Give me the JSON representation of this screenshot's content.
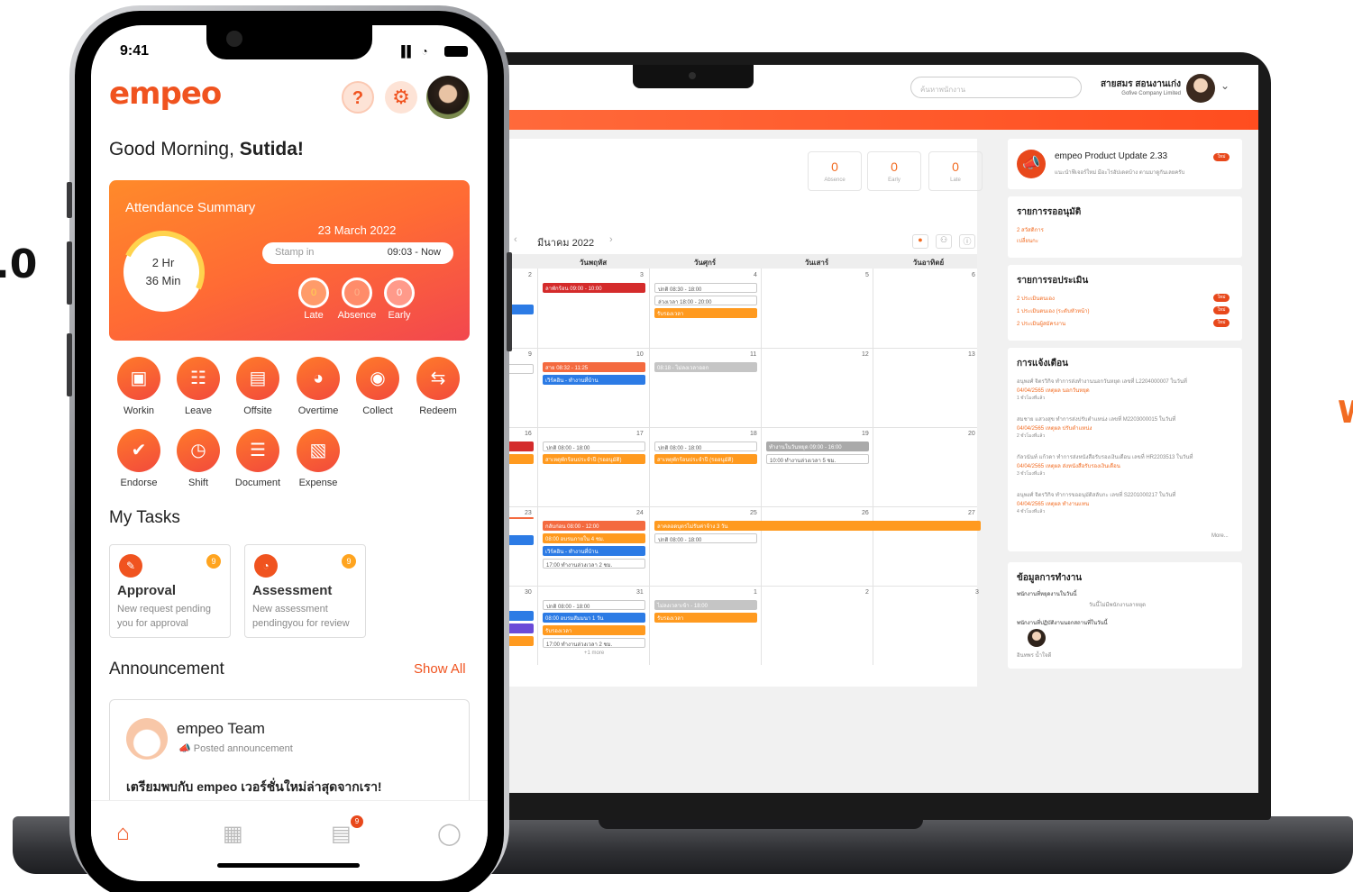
{
  "edge": {
    "left_text": ".0",
    "right_text": "W"
  },
  "web": {
    "search_placeholder": "ค้นหาพนักงาน",
    "user_name": "สายสมร สอนงานเก่ง",
    "company": "Gofive Company Limited",
    "counters": [
      {
        "value": "0",
        "label": "Absence"
      },
      {
        "value": "0",
        "label": "Early"
      },
      {
        "value": "0",
        "label": "Late"
      }
    ],
    "month": "มีนาคม 2022",
    "weekdays": [
      "วันพฤหัส",
      "วันศุกร์",
      "วันเสาร์",
      "วันอาทิตย์"
    ],
    "weeks": [
      {
        "days": [
          "2",
          "3",
          "4",
          "5",
          "6"
        ]
      },
      {
        "days": [
          "9",
          "10",
          "11",
          "12",
          "13"
        ]
      },
      {
        "days": [
          "16",
          "17",
          "18",
          "19",
          "20"
        ]
      },
      {
        "days": [
          "23",
          "24",
          "25",
          "26",
          "27"
        ]
      },
      {
        "days": [
          "30",
          "31",
          "1",
          "2",
          "3"
        ]
      }
    ],
    "events": {
      "e1": "ลาพักร้อน 09:00 - 10:00",
      "e2": "ปกติ 08:30 - 18:00",
      "e3": "ล่วงเวลา 18:00 - 20:00",
      "e4": "รับรองเวลา",
      "e5": "สาย 08:32 - 11:25",
      "e6": "เวิร์คอิน - ทำงานที่บ้าน",
      "e7": "08:18 - ไม่ลงเวลาออก",
      "e8": "ปกติ 08:00 - 18:00",
      "e9": "สาเหตุพักร้อนประจำปี (รออนุมัติ)",
      "e10": "ปกติ 08:00 - 18:00",
      "e11": "สาเหตุพักร้อนประจำปี (รออนุมัติ)",
      "e12": "ทำงานในวันหยุด 09:00 - 16:00",
      "e13": "10:00 ทำงานล่วงเวลา 5 ชม.",
      "e14": "กลับก่อน 08:00 - 12:00",
      "e15": "08:00 อบรมภายใน 4 ชม.",
      "e16": "เวิร์คอิน - ทำงานที่บ้าน",
      "e17": "17:00 ทำงานล่วงเวลา 2 ชม.",
      "e18": "ลาคลอดบุตรไม่รับค่าจ้าง 3 วัน",
      "e19": "ปกติ 08:00 - 18:00",
      "e20": "ปกติ 08:00 - 18:00",
      "e21": "08:00 อบรมสัมมนา 1 วัน",
      "e22": "รับรองเวลา",
      "e23": "17:00 ทำงานล่วงเวลา 2 ชม.",
      "e24": "+1 more",
      "e25": "ไม่ลงเวลาเข้า - 18:00",
      "e26": "รับรองเวลา"
    },
    "product_update": {
      "title": "empeo Product Update 2.33",
      "badge": "ใหม่",
      "desc": "แนะนำฟีเจอร์ใหม่ มีอะไรอัปเดตบ้าง ตามมาดูกันเลยครับ"
    },
    "approval_card": {
      "title": "รายการรออนุมัติ",
      "l1": "2 สวัสดิการ",
      "l2": "เปลี่ยนกะ"
    },
    "assess_card": {
      "title": "รายการรอประเมิน",
      "l1": "2 ประเมินตนเอง",
      "l2": "1 ประเมินตนเอง (ระดับหัวหน้า)",
      "l3": "2 ประเมินผู้สมัครงาน",
      "badge": "ใหม่"
    },
    "notif_card": {
      "title": "การแจ้งเตือน",
      "items": [
        {
          "a": "อนุพงศ์ จิตรวิกิจ ทำการส่งทำงานนอกวันหยุด เลขที่ L2204000007 ในวันที่",
          "b": "04/04/2565 เหตุผล นอกวันหยุด",
          "c": "1 ชั่วโมงที่แล้ว"
        },
        {
          "a": "สมชาย แสวงสุข ทำการส่งปรับตำแหน่ง เลขที่ M2203000015 ในวันที่",
          "b": "04/04/2565 เหตุผล ปรับตำแหน่ง",
          "c": "2 ชั่วโมงที่แล้ว"
        },
        {
          "a": "กัลวนันท์ แก้วดา ทำการส่งหนังสือรับรองเงินเดือน เลขที่ HR2203513 ในวันที่",
          "b": "04/04/2565 เหตุผล ส่งหนังสือรับรองเงินเดือน",
          "c": "3 ชั่วโมงที่แล้ว"
        },
        {
          "a": "อนุพงศ์ จิตรวิกิจ ทำการขออนุมัติสลับกะ เลขที่ S2201000217 ในวันที่",
          "b": "04/04/2565 เหตุผล ทำงานแทน",
          "c": "4 ชั่วโมงที่แล้ว"
        }
      ],
      "more": "More..."
    },
    "work_card": {
      "title": "ข้อมูลการทำงาน",
      "l1": "พนักงานที่หยุดงานในวันนี้",
      "l2": "วันนี้ไม่มีพนักงานลาหยุด",
      "l3": "พนักงานที่ปฏิบัติงานนอกสถานที่ในวันนี้",
      "l4": "อินทพร น้ำใจดี"
    }
  },
  "phone": {
    "time": "9:41",
    "signal": "▐▌ ◔",
    "logo": "empeo",
    "greeting_prefix": "Good Morning,",
    "greeting_name": "Sutida!",
    "attendance": {
      "title": "Attendance Summary",
      "hours": "2 Hr",
      "minutes": "36 Min",
      "date": "23 March 2022",
      "stamp_label": "Stamp in",
      "stamp_value": "09:03 - Now",
      "late_value": "0",
      "late_label": "Late",
      "absence_value": "0",
      "absence_label": "Absence",
      "early_value": "0",
      "early_label": "Early"
    },
    "menu": [
      {
        "label": "Workin",
        "icon": "▣"
      },
      {
        "label": "Leave",
        "icon": "☷"
      },
      {
        "label": "Offsite",
        "icon": "▤"
      },
      {
        "label": "Overtime",
        "icon": "◕"
      },
      {
        "label": "Collect",
        "icon": "◉"
      },
      {
        "label": "Redeem",
        "icon": "⇆"
      },
      {
        "label": "Endorse",
        "icon": "✔"
      },
      {
        "label": "Shift",
        "icon": "◷"
      },
      {
        "label": "Document",
        "icon": "☰"
      },
      {
        "label": "Expense",
        "icon": "▧"
      }
    ],
    "tasks_title": "My Tasks",
    "tasks": [
      {
        "title": "Approval",
        "desc": "New request pending you for approval",
        "badge": "9"
      },
      {
        "title": "Assessment",
        "desc": "New assessment pendingyou for review",
        "badge": "9"
      }
    ],
    "ann_title": "Announcement",
    "show_all": "Show All",
    "ann": {
      "name": "empeo Team",
      "sub": "Posted announcement",
      "body": "เตรียมพบกับ empeo เวอร์ชั่นใหม่ล่าสุดจากเรา!"
    },
    "tab_badge": "9"
  }
}
